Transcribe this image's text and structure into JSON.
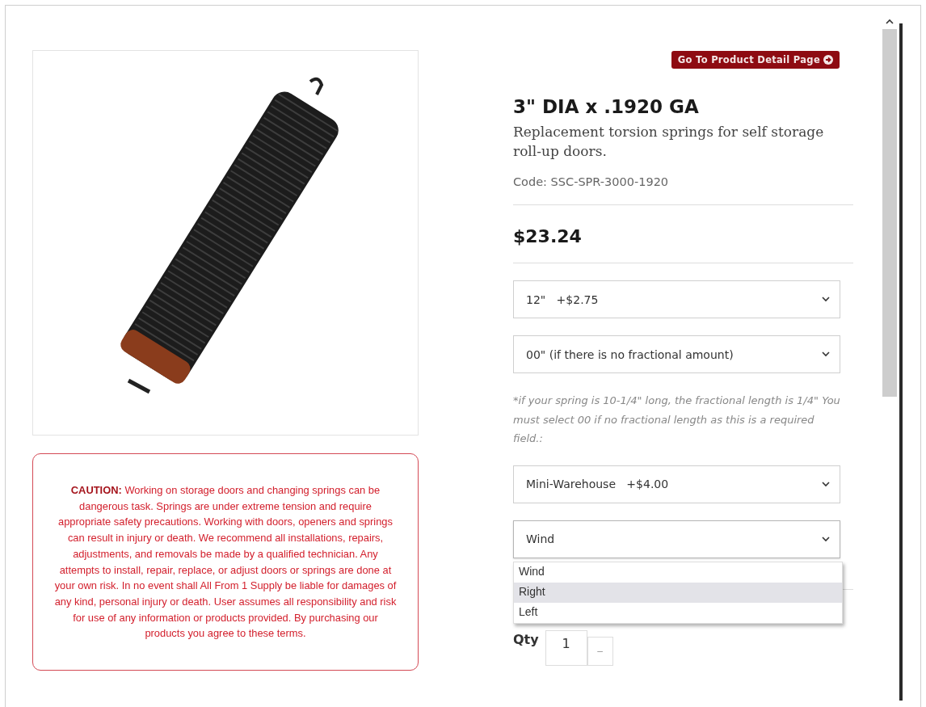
{
  "caution": "**CAUTION:** Working on storage doors and changing springs can be dangerous task. Springs are under extreme tension and require appropriate safety precautions. Working with doors, openers and springs can result in injury or death. We recommend all installations, repairs, adjustments, and removals be made by a qualified technician. Any attempts to install, repair, replace, or adjust doors or springs are done at your own risk. In no event shall All From 1 Supply be liable for damages of any kind, personal injury or death. User assumes all responsibility and risk for use of any information or products provided. By purchasing our products you agree to these terms.",
  "detail_button": "Go To Product Detail Page",
  "title": "3\" DIA x .1920 GA",
  "subtitle": "Replacement torsion springs for self storage roll-up doors.",
  "code": "Code: SSC-SPR-3000-1920",
  "price": "$23.24",
  "options": [
    {
      "kind": "select",
      "value": "12\"   +$2.75",
      "expanded": false
    },
    {
      "kind": "select",
      "value": "00\" (if there is no fractional amount)",
      "expanded": false
    },
    {
      "kind": "note",
      "text": "*if your spring is 10-1/4\" long, the fractional length is 1/4\" You must select 00 if no fractional length as this is a required field.:"
    },
    {
      "kind": "select",
      "value": "Mini-Warehouse   +$4.00",
      "expanded": false
    },
    {
      "kind": "select",
      "value": "Wind",
      "expanded": true,
      "choices": [
        {
          "label": "Wind",
          "highlighted": false
        },
        {
          "label": "Right",
          "highlighted": true
        },
        {
          "label": "Left",
          "highlighted": false
        }
      ]
    }
  ],
  "quantity": {
    "label": "Qty",
    "value": "1",
    "decrement": "–"
  }
}
